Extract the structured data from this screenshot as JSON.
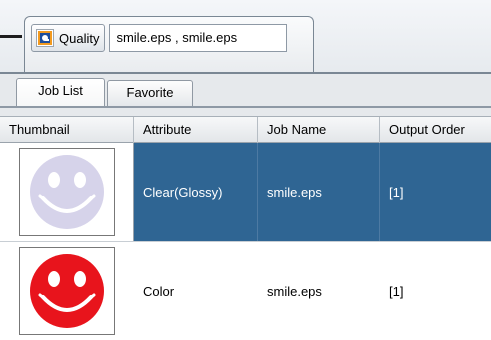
{
  "toolbar": {
    "quality_label": "Quality",
    "quality_icon": "quality-icon",
    "filename_value": "smile.eps , smile.eps"
  },
  "tabs": [
    {
      "label": "Job List",
      "active": true
    },
    {
      "label": "Favorite",
      "active": false
    }
  ],
  "table": {
    "columns": [
      "Thumbnail",
      "Attribute",
      "Job Name",
      "Output Order"
    ],
    "rows": [
      {
        "thumbnail": "smiley-glossy-thumbnail",
        "attribute": "Clear(Glossy)",
        "job_name": "smile.eps",
        "output_order": "[1]",
        "selected": true
      },
      {
        "thumbnail": "smiley-color-thumbnail",
        "attribute": "Color",
        "job_name": "smile.eps",
        "output_order": "[1]",
        "selected": false
      }
    ]
  },
  "colors": {
    "selection": "#2f6593",
    "glossy_face": "#d6d3ea",
    "color_face": "#e8141c",
    "quality_icon_orange": "#f29a1f",
    "quality_icon_blue": "#1d4e9c"
  }
}
